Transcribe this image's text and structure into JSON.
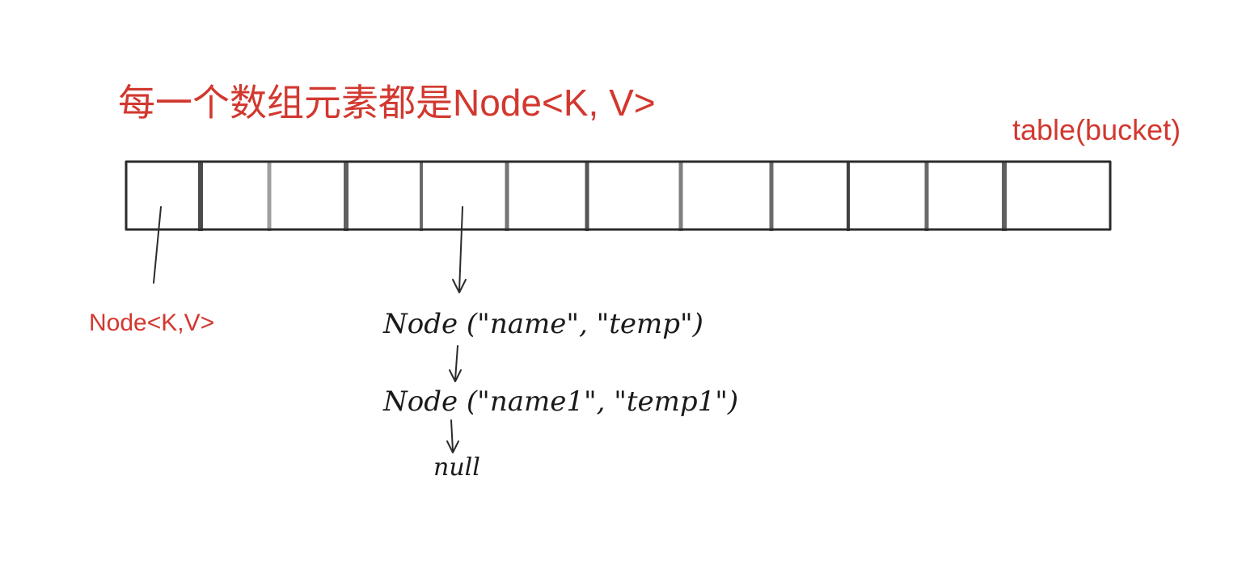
{
  "title": "每一个数组元素都是Node<K, V>",
  "table_label": "table(bucket)",
  "slot_label": "Node<K,V>",
  "chain": [
    "Node (\"name\", \"temp\")",
    "Node (\"name1\", \"temp1\")",
    "null"
  ],
  "colors": {
    "label": "#d2382f",
    "ink": "#2b2b2b"
  }
}
